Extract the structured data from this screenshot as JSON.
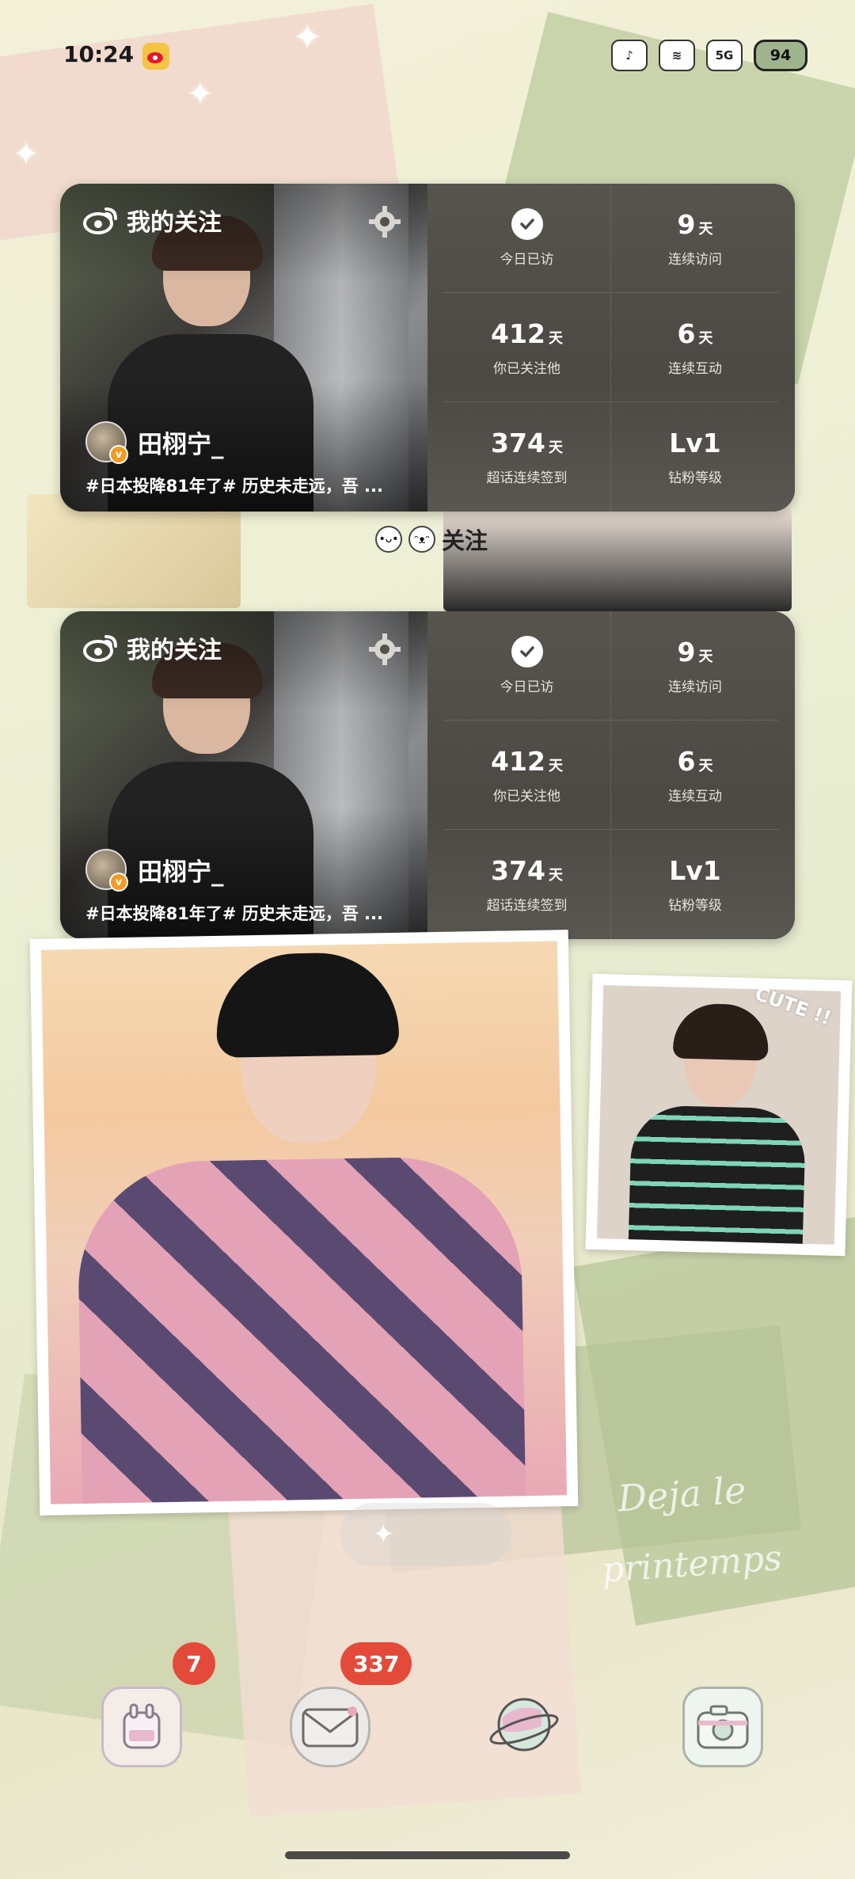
{
  "status_bar": {
    "time": "10:24",
    "network": "5G",
    "battery": "94"
  },
  "widgets": [
    {
      "title": "我的关注",
      "user_name": "田栩宁_",
      "topic": "#日本投降81年了# 历史未走远，吾 ...",
      "caption": "关注",
      "stats": [
        {
          "value": "",
          "unit": "",
          "label": "今日已访",
          "icon": "check-icon"
        },
        {
          "value": "9",
          "unit": "天",
          "label": "连续访问"
        },
        {
          "value": "412",
          "unit": "天",
          "label": "你已关注他"
        },
        {
          "value": "6",
          "unit": "天",
          "label": "连续互动"
        },
        {
          "value": "374",
          "unit": "天",
          "label": "超话连续签到"
        },
        {
          "value": "Lv1",
          "unit": "",
          "label": "钻粉等级"
        }
      ]
    },
    {
      "title": "我的关注",
      "user_name": "田栩宁_",
      "topic": "#日本投降81年了# 历史未走远，吾 ...",
      "caption": "关注",
      "stats": [
        {
          "value": "",
          "unit": "",
          "label": "今日已访",
          "icon": "check-icon"
        },
        {
          "value": "9",
          "unit": "天",
          "label": "连续访问"
        },
        {
          "value": "412",
          "unit": "天",
          "label": "你已关注他"
        },
        {
          "value": "6",
          "unit": "天",
          "label": "连续互动"
        },
        {
          "value": "374",
          "unit": "天",
          "label": "超话连续签到"
        },
        {
          "value": "Lv1",
          "unit": "",
          "label": "钻粉等级"
        }
      ]
    }
  ],
  "photo_small_text": "CUTE !!",
  "deco": {
    "line1": "Deja le",
    "line2": "printemps"
  },
  "dock": {
    "badges": {
      "app1": "7",
      "app2": "337"
    }
  },
  "colors": {
    "badge": "#e44a3a",
    "widget_bg": "#4a4744"
  }
}
